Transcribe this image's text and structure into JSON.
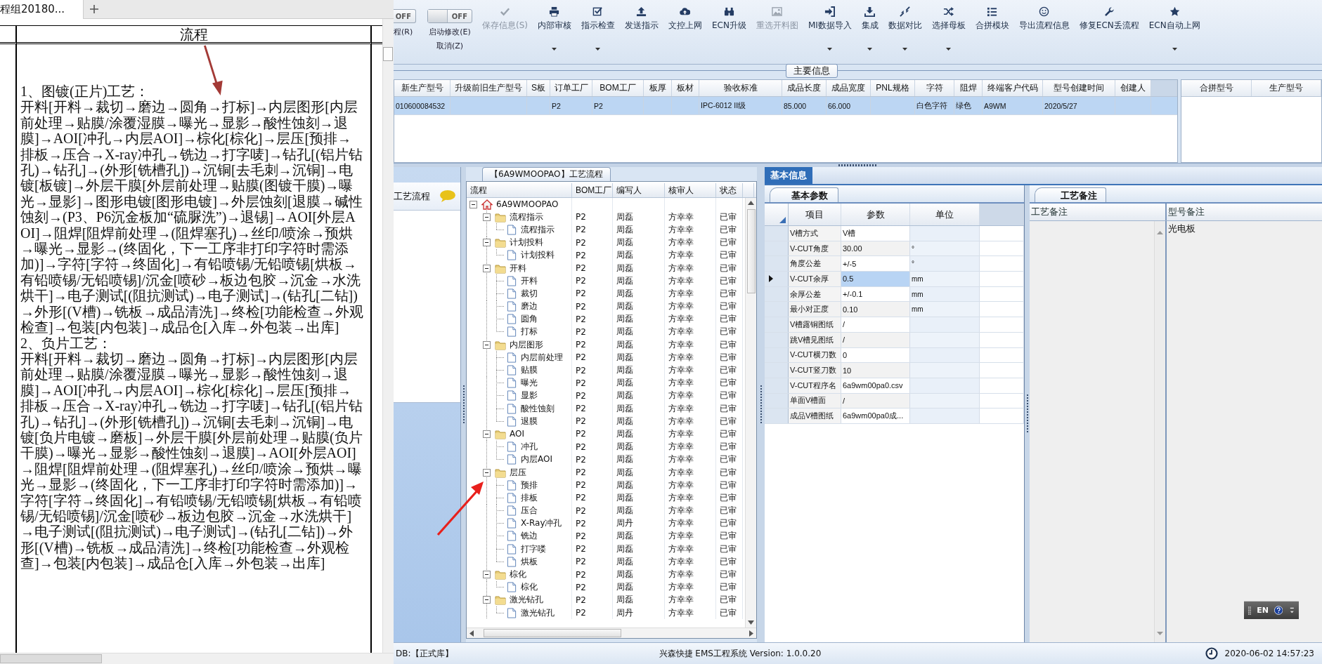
{
  "doc_tab": {
    "title": "程组20180..."
  },
  "doc": {
    "header": "流程",
    "paragraphs": [
      "1、图镀(正片)工艺：",
      "开料[开料→裁切→磨边→圆角→打标]→内层图形[内层前处理→贴膜/涂覆湿膜→曝光→显影→酸性蚀刻→退膜]→AOI[冲孔→内层AOI]→棕化[棕化]→层压[预排→排板→压合→X-ray冲孔→铣边→打字唛]→钻孔[(铝片钻孔)→钻孔]→(外形[铣槽孔])→沉铜[去毛刺→沉铜]→电镀[板镀]→外层干膜[外层前处理→贴膜(图镀干膜)→曝光→显影]→图形电镀[图形电镀]→外层蚀刻[退膜→碱性蚀刻→(P3、P6沉金板加“硫脲洗”)→退锡]→AOI[外层AOI]→阻焊[阻焊前处理→(阻焊塞孔)→丝印/喷涂→预烘→曝光→显影→(终固化，下一工序非打印字符时需添加)]→字符[字符→终固化]→有铅喷锡/无铅喷锡[烘板→有铅喷锡/无铅喷锡]/沉金[喷砂→板边包胶→沉金→水洗烘干]→电子测试[(阻抗测试)→电子测试]→(钻孔[二钻])→外形[(V槽)→铣板→成品清洗]→终检[功能检查→外观检查]→包装[内包装]→成品仓[入库→外包装→出库]",
      "2、负片工艺：",
      "开料[开料→裁切→磨边→圆角→打标]→内层图形[内层前处理→贴膜/涂覆湿膜→曝光→显影→酸性蚀刻→退膜]→AOI[冲孔→内层AOI]→棕化[棕化]→层压[预排→排板→压合→X-ray冲孔→铣边→打字唛]→钻孔[(铝片钻孔)→钻孔]→(外形[铣槽孔])→沉铜[去毛刺→沉铜]→电镀[负片电镀→磨板]→外层干膜[外层前处理→贴膜(负片干膜)→曝光→显影→酸性蚀刻→退膜]→AOI[外层AOI]→阻焊[阻焊前处理→(阻焊塞孔)→丝印/喷涂→预烘→曝光→显影→(终固化，下一工序非打印字符时需添加)]→字符[字符→终固化]→有铅喷锡/无铅喷锡[烘板→有铅喷锡/无铅喷锡]/沉金[喷砂→板边包胶→沉金→水洗烘干]→电子测试[(阻抗测试)→电子测试]→(钻孔[二钻])→外形[(V槽)→铣板→成品清洗]→终检[功能检查→外观检查]→包装[内包装]→成品仓[入库→外包装→出库]"
    ]
  },
  "toolbar": {
    "partial_toggle": {
      "label": "OFF",
      "on": false
    },
    "partial_label": "程(R)",
    "toggle": {
      "label": "OFF",
      "on": false
    },
    "toggle_labels": [
      "启动修改(E)",
      "取消(Z)"
    ],
    "items": [
      {
        "label": "保存信息(S)",
        "disabled": true,
        "dropdown": false
      },
      {
        "label": "内部审核",
        "disabled": false,
        "dropdown": true
      },
      {
        "label": "指示检查",
        "disabled": false,
        "dropdown": true
      },
      {
        "label": "发送指示",
        "disabled": false,
        "dropdown": false
      },
      {
        "label": "文控上网",
        "disabled": false,
        "dropdown": false
      },
      {
        "label": "ECN升级",
        "disabled": false,
        "dropdown": false
      },
      {
        "label": "重选开料图",
        "disabled": true,
        "dropdown": false
      },
      {
        "label": "MI数据导入",
        "disabled": false,
        "dropdown": true
      },
      {
        "label": "集成",
        "disabled": false,
        "dropdown": true
      },
      {
        "label": "数据对比",
        "disabled": false,
        "dropdown": true
      },
      {
        "label": "选择母板",
        "disabled": false,
        "dropdown": true
      },
      {
        "label": "合拼模块",
        "disabled": false,
        "dropdown": false
      },
      {
        "label": "导出流程信息",
        "disabled": false,
        "dropdown": false
      },
      {
        "label": "修复ECN丢流程",
        "disabled": false,
        "dropdown": false
      },
      {
        "label": "ECN自动上网",
        "disabled": false,
        "dropdown": true
      }
    ]
  },
  "main_info": {
    "title": "主要信息",
    "columns": [
      "新生产型号",
      "升级前旧生产型号",
      "S板",
      "订单工厂",
      "BOM工厂",
      "板厚",
      "板材",
      "验收标准",
      "成品长度",
      "成品宽度",
      "PNL规格",
      "字符",
      "阻焊",
      "终端客户代码",
      "型号创建时间",
      "创建人"
    ],
    "rows": [
      {
        "selected": true,
        "cells": [
          "010600084532",
          null,
          null,
          "P2",
          "P2",
          null,
          null,
          "IPC-6012 II级",
          "85.000",
          "66.000",
          null,
          "白色字符",
          "绿色",
          "A9WM",
          "2020/5/27",
          null
        ]
      }
    ],
    "merge_columns": [
      "合拼型号",
      "生产型号"
    ]
  },
  "flow_panel": {
    "label": "工艺流程"
  },
  "tree": {
    "title": "【6A9WMOOPAO】工艺流程",
    "columns": [
      "流程",
      "BOM工厂",
      "编写人",
      "核审人",
      "状态"
    ],
    "root": {
      "name": "6A9WMOOPAO",
      "expanded": true,
      "children": [
        {
          "name": "流程指示",
          "expanded": true,
          "bom": "P2",
          "writer": "周磊",
          "reviewer": "方幸幸",
          "status": "已审",
          "children": [
            {
              "name": "流程指示",
              "bom": "P2",
              "writer": "周磊",
              "reviewer": "方幸幸",
              "status": "已审"
            }
          ]
        },
        {
          "name": "计划投料",
          "expanded": true,
          "bom": "P2",
          "writer": "周磊",
          "reviewer": "方幸幸",
          "status": "已审",
          "children": [
            {
              "name": "计划投料",
              "bom": "P2",
              "writer": "周磊",
              "reviewer": "方幸幸",
              "status": "已审"
            }
          ]
        },
        {
          "name": "开料",
          "expanded": true,
          "bom": "P2",
          "writer": "周磊",
          "reviewer": "方幸幸",
          "status": "已审",
          "children": [
            {
              "name": "开料",
              "bom": "P2",
              "writer": "周磊",
              "reviewer": "方幸幸",
              "status": "已审"
            },
            {
              "name": "裁切",
              "bom": "P2",
              "writer": "周磊",
              "reviewer": "方幸幸",
              "status": "已审"
            },
            {
              "name": "磨边",
              "bom": "P2",
              "writer": "周磊",
              "reviewer": "方幸幸",
              "status": "已审"
            },
            {
              "name": "圆角",
              "bom": "P2",
              "writer": "周磊",
              "reviewer": "方幸幸",
              "status": "已审"
            },
            {
              "name": "打标",
              "bom": "P2",
              "writer": "周磊",
              "reviewer": "方幸幸",
              "status": "已审"
            }
          ]
        },
        {
          "name": "内层图形",
          "expanded": true,
          "bom": "P2",
          "writer": "周磊",
          "reviewer": "方幸幸",
          "status": "已审",
          "children": [
            {
              "name": "内层前处理",
              "bom": "P2",
              "writer": "周磊",
              "reviewer": "方幸幸",
              "status": "已审"
            },
            {
              "name": "贴膜",
              "bom": "P2",
              "writer": "周磊",
              "reviewer": "方幸幸",
              "status": "已审"
            },
            {
              "name": "曝光",
              "bom": "P2",
              "writer": "周磊",
              "reviewer": "方幸幸",
              "status": "已审"
            },
            {
              "name": "显影",
              "bom": "P2",
              "writer": "周磊",
              "reviewer": "方幸幸",
              "status": "已审"
            },
            {
              "name": "酸性蚀刻",
              "bom": "P2",
              "writer": "周磊",
              "reviewer": "方幸幸",
              "status": "已审"
            },
            {
              "name": "退膜",
              "bom": "P2",
              "writer": "周磊",
              "reviewer": "方幸幸",
              "status": "已审"
            }
          ]
        },
        {
          "name": "AOI",
          "expanded": true,
          "bom": "P2",
          "writer": "周磊",
          "reviewer": "方幸幸",
          "status": "已审",
          "children": [
            {
              "name": "冲孔",
              "bom": "P2",
              "writer": "周磊",
              "reviewer": "方幸幸",
              "status": "已审"
            },
            {
              "name": "内层AOI",
              "bom": "P2",
              "writer": "周磊",
              "reviewer": "方幸幸",
              "status": "已审"
            }
          ]
        },
        {
          "name": "层压",
          "expanded": true,
          "bom": "P2",
          "writer": "周磊",
          "reviewer": "方幸幸",
          "status": "已审",
          "children": [
            {
              "name": "预排",
              "bom": "P2",
              "writer": "周磊",
              "reviewer": "方幸幸",
              "status": "已审"
            },
            {
              "name": "排板",
              "bom": "P2",
              "writer": "周磊",
              "reviewer": "方幸幸",
              "status": "已审"
            },
            {
              "name": "压合",
              "bom": "P2",
              "writer": "周磊",
              "reviewer": "方幸幸",
              "status": "已审"
            },
            {
              "name": "X-Ray冲孔",
              "bom": "P2",
              "writer": "周丹",
              "reviewer": "方幸幸",
              "status": "已审"
            },
            {
              "name": "铣边",
              "bom": "P2",
              "writer": "周磊",
              "reviewer": "方幸幸",
              "status": "已审"
            },
            {
              "name": "打字喽",
              "bom": "P2",
              "writer": "周磊",
              "reviewer": "方幸幸",
              "status": "已审"
            },
            {
              "name": "烘板",
              "bom": "P2",
              "writer": "周磊",
              "reviewer": "方幸幸",
              "status": "已审"
            }
          ]
        },
        {
          "name": "棕化",
          "expanded": true,
          "bom": "P2",
          "writer": "周磊",
          "reviewer": "方幸幸",
          "status": "已审",
          "children": [
            {
              "name": "棕化",
              "bom": "P2",
              "writer": "周磊",
              "reviewer": "方幸幸",
              "status": "已审"
            }
          ]
        },
        {
          "name": "激光钻孔",
          "expanded": true,
          "bom": "P2",
          "writer": "周磊",
          "reviewer": "方幸幸",
          "status": "已审",
          "children": [
            {
              "name": "激光钻孔",
              "bom": "P2",
              "writer": "周丹",
              "reviewer": "方幸幸",
              "status": "已审"
            }
          ]
        }
      ]
    }
  },
  "info_tab": {
    "label": "基本信息",
    "selected": true
  },
  "params": {
    "tab": "基本参数",
    "columns": [
      "项目",
      "参数",
      "单位"
    ],
    "rows": [
      {
        "item": "V槽方式",
        "value": "V槽",
        "selected": false
      },
      {
        "item": "V-CUT角度",
        "value": "30.00",
        "unit": "°",
        "selected": false
      },
      {
        "item": "角度公差",
        "value": "+/-5",
        "unit": "°",
        "selected": false
      },
      {
        "item": "V-CUT余厚",
        "value": "0.5",
        "unit": "mm",
        "selected": true
      },
      {
        "item": "余厚公差",
        "value": "+/-0.1",
        "unit": "mm",
        "selected": false
      },
      {
        "item": "最小对正度",
        "value": "0.10",
        "unit": "mm",
        "selected": false
      },
      {
        "item": "V槽露铜图纸",
        "value": "/",
        "selected": false
      },
      {
        "item": "跳V槽见图纸",
        "value": "/",
        "selected": false
      },
      {
        "item": "V-CUT横刀数",
        "value": "0",
        "selected": false
      },
      {
        "item": "V-CUT竖刀数",
        "value": "10",
        "selected": false
      },
      {
        "item": "V-CUT程序名",
        "value": "6a9wm00pa0.csv",
        "selected": false
      },
      {
        "item": "单面V槽面",
        "value": "/",
        "selected": false
      },
      {
        "item": "成品V槽图纸",
        "value": "6a9wm00pa0成...",
        "selected": false
      }
    ]
  },
  "notes": {
    "tab": "工艺备注",
    "columns": [
      "工艺备注",
      "型号备注"
    ],
    "model_note": "光电板"
  },
  "ime": {
    "label": "EN"
  },
  "status_bar": {
    "db": "DB:【正式库】",
    "app": "兴森快捷 EMS工程系统 Version: 1.0.0.20",
    "time": "2020-06-02 14:57:23"
  }
}
